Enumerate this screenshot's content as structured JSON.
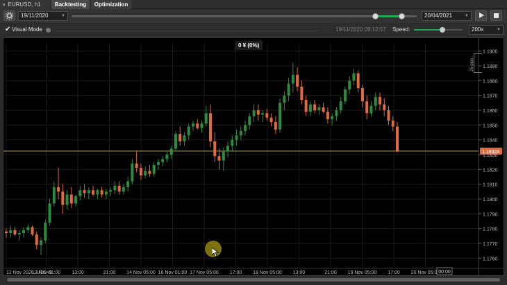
{
  "tabs": {
    "symbol": "EURUSD, h1",
    "backtesting": "Backtesting",
    "optimization": "Optimization"
  },
  "controls": {
    "settings_icon": "gear-icon",
    "start_date": "19/11/2020",
    "end_date": "20/04/2021",
    "play_icon": "play-icon",
    "stop_icon": "stop-icon"
  },
  "visual_row": {
    "visual_mode_label": "Visual Mode",
    "visual_mode_checked": true,
    "current_time": "19/11/2020 09:12:57",
    "speed_label": "Speed:",
    "speed_value": "200x"
  },
  "chart": {
    "pnl_label": "0 ¥ (0%)",
    "pips_label": "25 pips",
    "current_price": "1.18324",
    "price_line_color": "#c9a227",
    "bull_color": "#2e8b3d",
    "bear_color": "#e06a3a",
    "time_marker": "00:00",
    "x_ticks": [
      "12 Nov 2020, UTC+9",
      "13 Nov 01:00",
      "13:00",
      "21:00",
      "14 Nov 05:00",
      "16 Nov 01:00",
      "17 Nov 05:00",
      "17:00",
      "18 Nov 05:00",
      "13:00",
      "21:00",
      "19 Nov 05:00",
      "17:00",
      "20 Nov 05:00"
    ]
  },
  "chart_data": {
    "type": "candlestick",
    "symbol": "EURUSD, h1",
    "y_ticks": [
      "1.1900",
      "1.1890",
      "1.1880",
      "1.1870",
      "1.1860",
      "1.1850",
      "1.1840",
      "1.1830",
      "1.1820",
      "1.1810",
      "1.1800",
      "1.1790",
      "1.1780",
      "1.1770",
      "1.1760"
    ],
    "ylim": [
      1.1755,
      1.1905
    ],
    "current_price": 1.18324,
    "candles": [
      [
        1.1778,
        1.178,
        1.1774,
        1.1777
      ],
      [
        1.1777,
        1.1782,
        1.1774,
        1.1779
      ],
      [
        1.1779,
        1.1781,
        1.1775,
        1.1776
      ],
      [
        1.1776,
        1.1779,
        1.1772,
        1.1777
      ],
      [
        1.1777,
        1.1781,
        1.1774,
        1.1779
      ],
      [
        1.1779,
        1.1783,
        1.1777,
        1.1781
      ],
      [
        1.1781,
        1.1782,
        1.1775,
        1.1776
      ],
      [
        1.1776,
        1.1778,
        1.1766,
        1.1769
      ],
      [
        1.1769,
        1.1774,
        1.1762,
        1.1772
      ],
      [
        1.1772,
        1.1786,
        1.177,
        1.1784
      ],
      [
        1.1784,
        1.18,
        1.1782,
        1.1797
      ],
      [
        1.1797,
        1.1812,
        1.1795,
        1.1808
      ],
      [
        1.1808,
        1.1821,
        1.18,
        1.1805
      ],
      [
        1.1805,
        1.181,
        1.179,
        1.1796
      ],
      [
        1.1796,
        1.1806,
        1.1793,
        1.1803
      ],
      [
        1.1803,
        1.1808,
        1.1794,
        1.1797
      ],
      [
        1.1797,
        1.1803,
        1.1795,
        1.1802
      ],
      [
        1.1802,
        1.1809,
        1.1799,
        1.1806
      ],
      [
        1.1806,
        1.181,
        1.1801,
        1.1804
      ],
      [
        1.1804,
        1.1808,
        1.18,
        1.1806
      ],
      [
        1.1806,
        1.1809,
        1.1802,
        1.1803
      ],
      [
        1.1803,
        1.1807,
        1.18,
        1.1806
      ],
      [
        1.1806,
        1.1808,
        1.1801,
        1.1803
      ],
      [
        1.1803,
        1.1807,
        1.18,
        1.1805
      ],
      [
        1.1805,
        1.1808,
        1.1802,
        1.1806
      ],
      [
        1.1806,
        1.1812,
        1.1803,
        1.1809
      ],
      [
        1.1809,
        1.1812,
        1.1803,
        1.1805
      ],
      [
        1.1805,
        1.181,
        1.1803,
        1.1808
      ],
      [
        1.1808,
        1.1815,
        1.1805,
        1.1812
      ],
      [
        1.1812,
        1.1827,
        1.181,
        1.1824
      ],
      [
        1.1824,
        1.1832,
        1.1818,
        1.1821
      ],
      [
        1.1821,
        1.1824,
        1.1813,
        1.1816
      ],
      [
        1.1816,
        1.1822,
        1.1814,
        1.1819
      ],
      [
        1.1819,
        1.1823,
        1.1815,
        1.1817
      ],
      [
        1.1817,
        1.1825,
        1.1815,
        1.1823
      ],
      [
        1.1823,
        1.1827,
        1.182,
        1.1825
      ],
      [
        1.1825,
        1.1829,
        1.1822,
        1.1827
      ],
      [
        1.1827,
        1.1832,
        1.1825,
        1.183
      ],
      [
        1.183,
        1.1836,
        1.1827,
        1.1834
      ],
      [
        1.1834,
        1.1846,
        1.1832,
        1.1844
      ],
      [
        1.1844,
        1.1849,
        1.1836,
        1.1839
      ],
      [
        1.1839,
        1.1845,
        1.1836,
        1.1843
      ],
      [
        1.1843,
        1.1851,
        1.184,
        1.1849
      ],
      [
        1.1849,
        1.1853,
        1.1846,
        1.1851
      ],
      [
        1.1851,
        1.1854,
        1.1847,
        1.1848
      ],
      [
        1.1848,
        1.1853,
        1.1845,
        1.1851
      ],
      [
        1.1851,
        1.1863,
        1.1849,
        1.1858
      ],
      [
        1.1858,
        1.1864,
        1.1835,
        1.1839
      ],
      [
        1.1839,
        1.1845,
        1.1825,
        1.1829
      ],
      [
        1.1829,
        1.1834,
        1.182,
        1.1826
      ],
      [
        1.1826,
        1.1835,
        1.1819,
        1.1832
      ],
      [
        1.1832,
        1.1839,
        1.1828,
        1.1836
      ],
      [
        1.1836,
        1.1843,
        1.1832,
        1.184
      ],
      [
        1.184,
        1.1847,
        1.1836,
        1.1843
      ],
      [
        1.1843,
        1.1849,
        1.184,
        1.1846
      ],
      [
        1.1846,
        1.1853,
        1.1843,
        1.185
      ],
      [
        1.185,
        1.1858,
        1.1847,
        1.1856
      ],
      [
        1.1856,
        1.1864,
        1.1852,
        1.186
      ],
      [
        1.186,
        1.1864,
        1.1853,
        1.1857
      ],
      [
        1.1857,
        1.186,
        1.1852,
        1.1858
      ],
      [
        1.1858,
        1.1861,
        1.1853,
        1.1855
      ],
      [
        1.1855,
        1.1858,
        1.1849,
        1.1852
      ],
      [
        1.1852,
        1.1856,
        1.1844,
        1.1847
      ],
      [
        1.1847,
        1.1868,
        1.1845,
        1.1865
      ],
      [
        1.1865,
        1.1873,
        1.186,
        1.187
      ],
      [
        1.187,
        1.1882,
        1.1866,
        1.1878
      ],
      [
        1.1878,
        1.1892,
        1.1872,
        1.1884
      ],
      [
        1.1884,
        1.1889,
        1.1873,
        1.1876
      ],
      [
        1.1876,
        1.188,
        1.1864,
        1.1867
      ],
      [
        1.1867,
        1.187,
        1.1856,
        1.1859
      ],
      [
        1.1859,
        1.1866,
        1.1856,
        1.1864
      ],
      [
        1.1864,
        1.1867,
        1.1858,
        1.186
      ],
      [
        1.186,
        1.1864,
        1.1857,
        1.1862
      ],
      [
        1.1862,
        1.1865,
        1.1858,
        1.1859
      ],
      [
        1.1859,
        1.1862,
        1.1851,
        1.1854
      ],
      [
        1.1854,
        1.1858,
        1.185,
        1.1856
      ],
      [
        1.1856,
        1.1862,
        1.1853,
        1.186
      ],
      [
        1.186,
        1.1869,
        1.1858,
        1.1866
      ],
      [
        1.1866,
        1.1876,
        1.1864,
        1.1874
      ],
      [
        1.1874,
        1.1883,
        1.1871,
        1.188
      ],
      [
        1.188,
        1.1888,
        1.1877,
        1.1885
      ],
      [
        1.1885,
        1.1887,
        1.1872,
        1.1875
      ],
      [
        1.1875,
        1.1877,
        1.1862,
        1.1866
      ],
      [
        1.1866,
        1.187,
        1.1854,
        1.1858
      ],
      [
        1.1858,
        1.1866,
        1.1856,
        1.1863
      ],
      [
        1.1863,
        1.1872,
        1.186,
        1.1869
      ],
      [
        1.1869,
        1.1872,
        1.186,
        1.1864
      ],
      [
        1.1864,
        1.1868,
        1.1856,
        1.186
      ],
      [
        1.186,
        1.1863,
        1.185,
        1.1853
      ],
      [
        1.1853,
        1.1856,
        1.1846,
        1.1849
      ],
      [
        1.1849,
        1.1852,
        1.1838,
        1.1832
      ]
    ]
  }
}
